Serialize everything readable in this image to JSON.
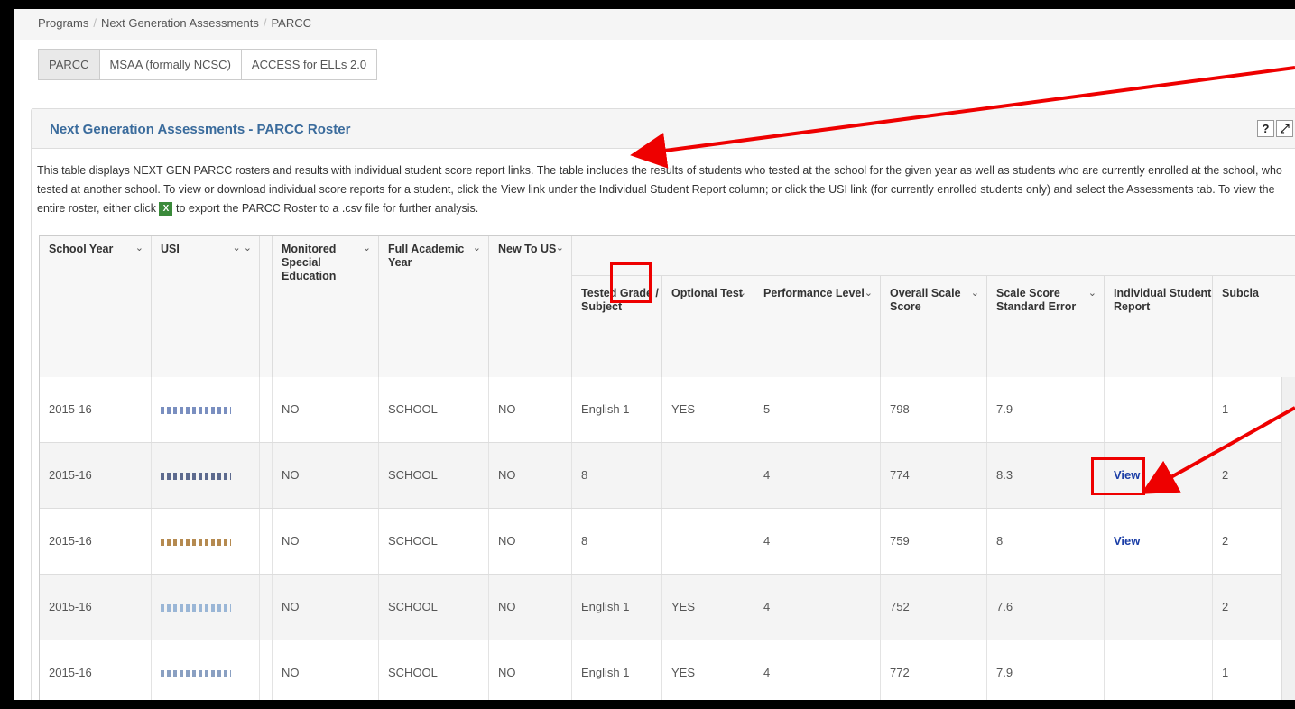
{
  "breadcrumb": [
    "Programs",
    "Next Generation Assessments",
    "PARCC"
  ],
  "tabs": [
    "PARCC",
    "MSAA (formally NCSC)",
    "ACCESS for ELLs 2.0"
  ],
  "panel": {
    "title": "Next Generation Assessments - PARCC Roster",
    "help_label": "?",
    "expand_label": "⤢",
    "description_1": "This table displays NEXT GEN PARCC rosters and results with individual student score report links. The table includes the results of students who tested at the school for the given year as well as students who are currently enrolled at the school, who tested at another school. To view or download individual score reports for a student, click the View link under the Individual Student Report column; or click the USI link (for currently enrolled students only) and select the Assessments tab. To view the entire roster, either click",
    "description_2": "to export the PARCC Roster to a .csv file for further analysis.",
    "excel_label": "X"
  },
  "columns": {
    "school_year": "School Year",
    "usi": "USI",
    "monitored": "Monitored Special Education",
    "full_academic": "Full Academic Year",
    "new_to_us": "New To US",
    "tested_grade": "Tested Grade / Subject",
    "optional": "Optional Test",
    "performance": "Performance Level",
    "overall_score": "Overall Scale Score",
    "std_error": "Scale Score Standard Error",
    "individual_report": "Individual Student Report",
    "subclaim": "Subcla"
  },
  "rows": [
    {
      "year": "2015-16",
      "mon": "NO",
      "fay": "SCHOOL",
      "new": "NO",
      "grade": "English 1",
      "opt": "YES",
      "perf": "5",
      "score": "798",
      "err": "7.9",
      "report": "",
      "sub": "1"
    },
    {
      "year": "2015-16",
      "mon": "NO",
      "fay": "SCHOOL",
      "new": "NO",
      "grade": "8",
      "opt": "",
      "perf": "4",
      "score": "774",
      "err": "8.3",
      "report": "View",
      "sub": "2"
    },
    {
      "year": "2015-16",
      "mon": "NO",
      "fay": "SCHOOL",
      "new": "NO",
      "grade": "8",
      "opt": "",
      "perf": "4",
      "score": "759",
      "err": "8",
      "report": "View",
      "sub": "2"
    },
    {
      "year": "2015-16",
      "mon": "NO",
      "fay": "SCHOOL",
      "new": "NO",
      "grade": "English 1",
      "opt": "YES",
      "perf": "4",
      "score": "752",
      "err": "7.6",
      "report": "",
      "sub": "2"
    },
    {
      "year": "2015-16",
      "mon": "NO",
      "fay": "SCHOOL",
      "new": "NO",
      "grade": "English 1",
      "opt": "YES",
      "perf": "4",
      "score": "772",
      "err": "7.9",
      "report": "",
      "sub": "1"
    }
  ],
  "colors": {
    "annotation": "#e00000",
    "link": "#1a3da6",
    "title": "#3a6b9c"
  }
}
